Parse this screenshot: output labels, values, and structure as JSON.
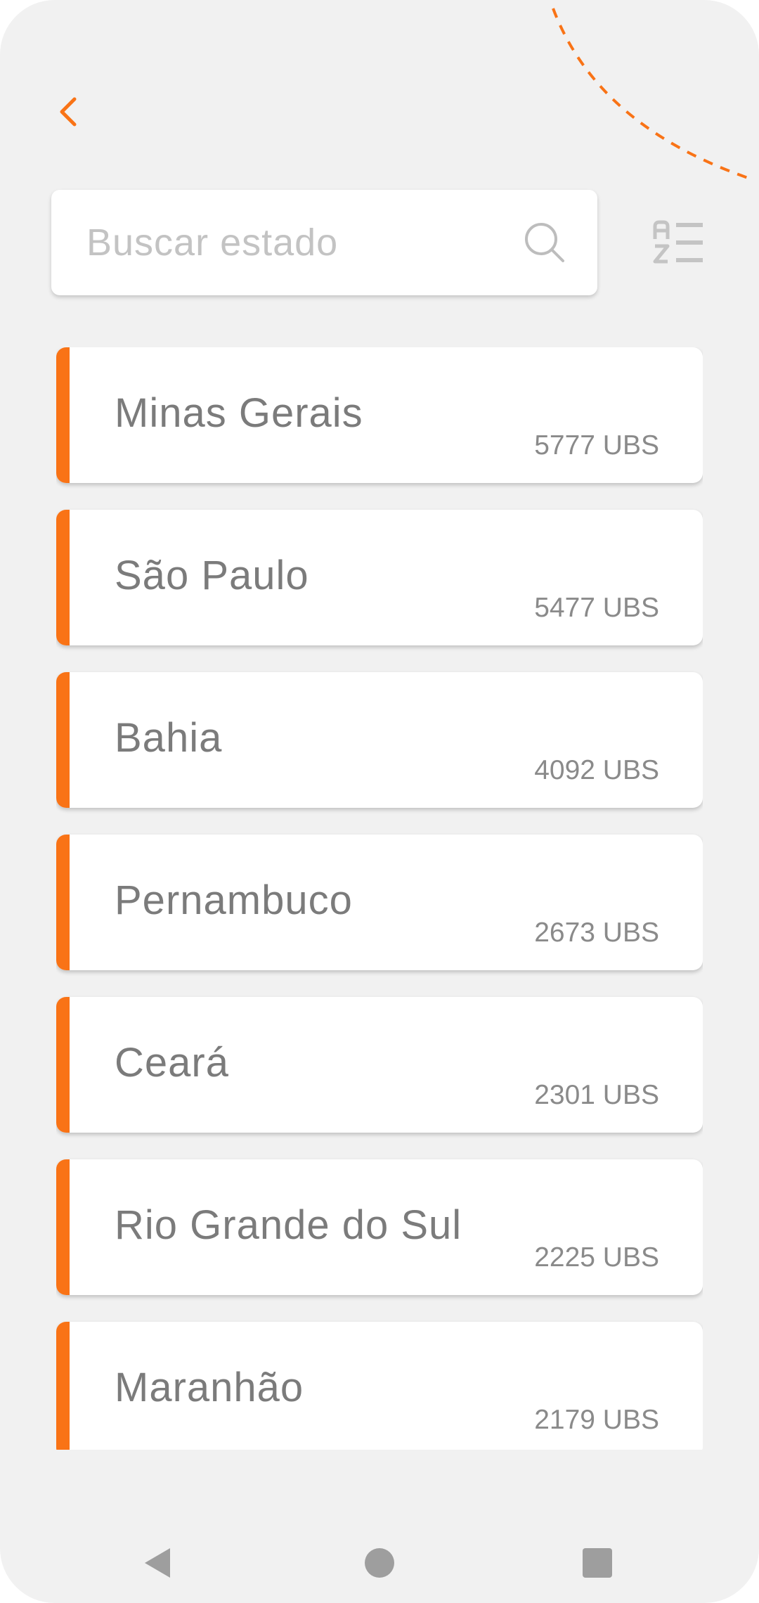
{
  "header": {
    "back_icon": "chevron-left-icon"
  },
  "search": {
    "placeholder": "Buscar estado",
    "value": "",
    "icon": "search-icon"
  },
  "sort": {
    "icon": "sort-alpha-icon"
  },
  "states": [
    {
      "name": "Minas Gerais",
      "count": "5777 UBS"
    },
    {
      "name": "São Paulo",
      "count": "5477 UBS"
    },
    {
      "name": "Bahia",
      "count": "4092 UBS"
    },
    {
      "name": "Pernambuco",
      "count": "2673 UBS"
    },
    {
      "name": "Ceará",
      "count": "2301 UBS"
    },
    {
      "name": "Rio Grande do Sul",
      "count": "2225 UBS"
    },
    {
      "name": "Maranhão",
      "count": "2179 UBS"
    }
  ],
  "nav": {
    "back": "nav-back-icon",
    "home": "nav-home-icon",
    "recents": "nav-recents-icon"
  },
  "colors": {
    "accent": "#f97316",
    "background": "#f1f1f1",
    "text": "#7b7b7b"
  }
}
